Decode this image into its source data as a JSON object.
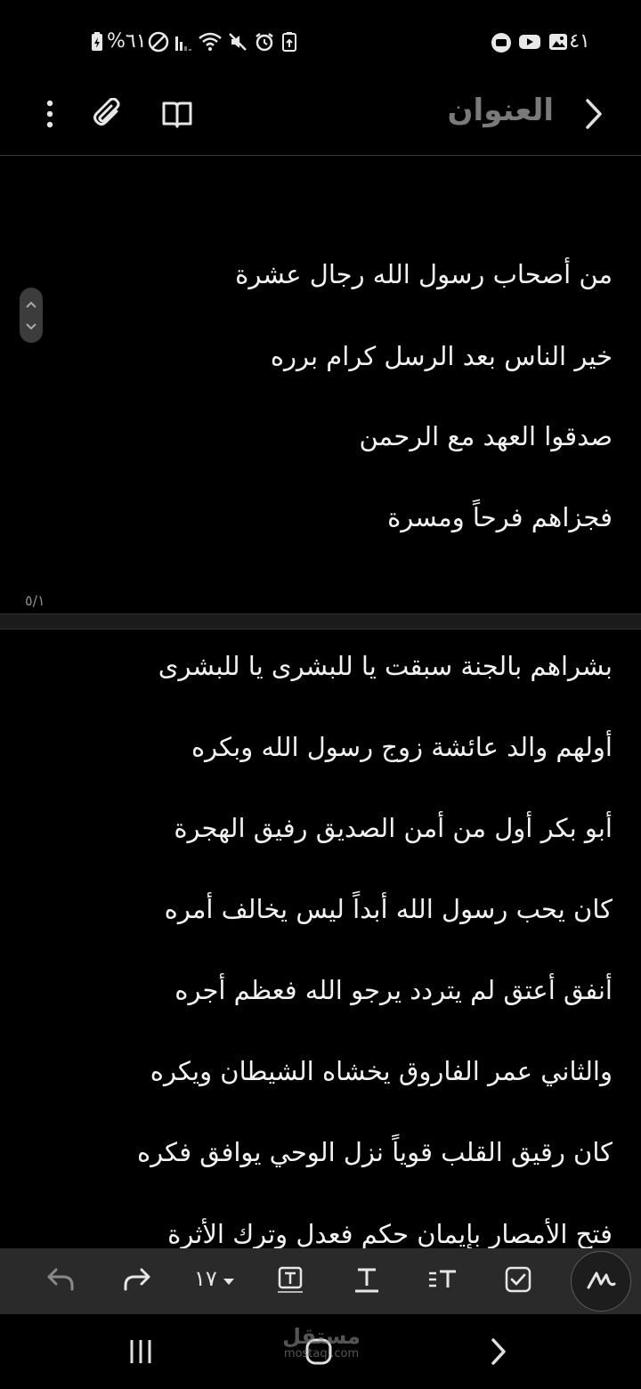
{
  "status_bar": {
    "time": "٦:٤١",
    "battery": "%٦١"
  },
  "app_bar": {
    "title": "العنوان"
  },
  "page1": {
    "lines": [
      "من أصحاب رسول الله رجال عشرة",
      "خير الناس بعد الرسل كرام برره",
      "صدقوا العهد مع الرحمن",
      "فجزاهم فرحاً ومسرة"
    ],
    "page_indicator": "٥/١"
  },
  "page2": {
    "lines": [
      "بشراهم بالجنة سبقت يا للبشرى يا للبشرى",
      "أولهم والد عائشة زوج رسول الله وبكره",
      "أبو بكر أول من أمن الصديق رفيق الهجرة",
      "كان يحب رسول الله أبداً ليس يخالف أمره",
      "أنفق أعتق لم يتردد يرجو الله فعظم أجره",
      "والثاني عمر الفاروق يخشاه الشيطان ويكره",
      "كان رقيق القلب قوياً نزل الوحي يوافق فكره",
      "فتح الأمصار بإيمان حكم فعدل وترك الأثرة"
    ]
  },
  "toolbar": {
    "font_size": "١٧"
  },
  "watermark": {
    "name": "مستقل",
    "domain": "mostaql.com"
  },
  "icons": [
    "more-vert-icon",
    "attach-icon",
    "reading-mode-icon",
    "back-icon",
    "undo-icon",
    "redo-icon",
    "text-box-icon",
    "text-style-icon",
    "text-align-icon",
    "checkbox-icon",
    "pen-icon",
    "recents-icon",
    "home-icon",
    "nav-back-icon"
  ]
}
